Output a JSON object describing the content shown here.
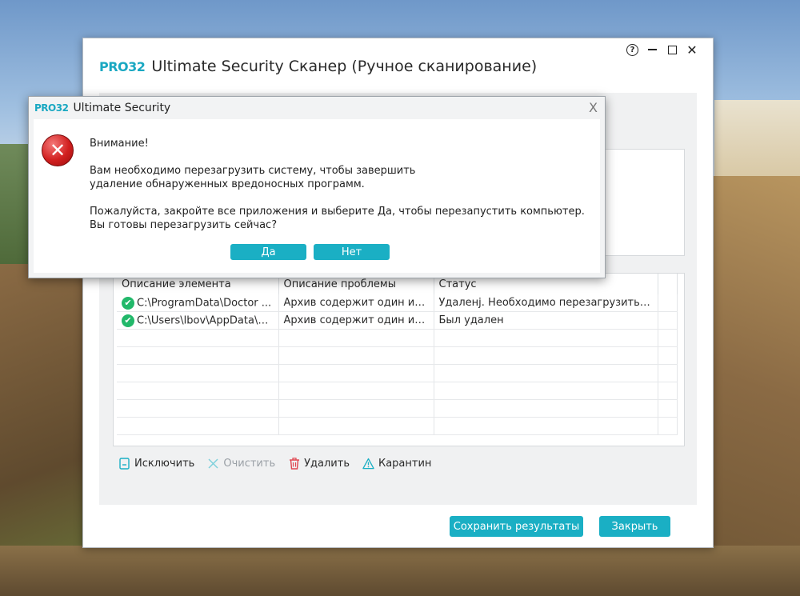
{
  "main_window": {
    "logo": "PRO32",
    "title": "Ultimate Security Сканер (Ручное сканирование)",
    "controls": {
      "help": "?",
      "close": "✕"
    }
  },
  "table": {
    "headers": [
      "Описание элемента",
      "Описание проблемы",
      "Статус"
    ],
    "rows": [
      {
        "item": "C:\\ProgramData\\Doctor ...",
        "problem": "Архив содержит один ил...",
        "status": "Удаленј. Необходимо перезагрузить с..."
      },
      {
        "item": "C:\\Users\\lbov\\AppData\\R...",
        "problem": "Архив содержит один ил...",
        "status": "Был удален"
      }
    ]
  },
  "actions": {
    "exclude": "Исключить",
    "clear": "Очистить",
    "delete": "Удалить",
    "quarantine": "Карантин"
  },
  "buttons": {
    "save": "Сохранить результаты",
    "close": "Закрыть"
  },
  "dialog": {
    "logo": "PRO32",
    "title": "Ultimate Security",
    "close": "X",
    "heading": "Внимание!",
    "line1": "Вам необходимо перезагрузить систему, чтобы завершить",
    "line2": "удаление обнаруженных вредоносных программ.",
    "line3": "Пожалуйста, закройте все приложения и выберите Да, чтобы перезапустить компьютер.",
    "line4": "Вы готовы перезагрузить сейчас?",
    "yes": "Да",
    "no": "Нет"
  },
  "colors": {
    "accent": "#1aafc4",
    "success": "#22b86a",
    "error": "#d11f1f"
  }
}
